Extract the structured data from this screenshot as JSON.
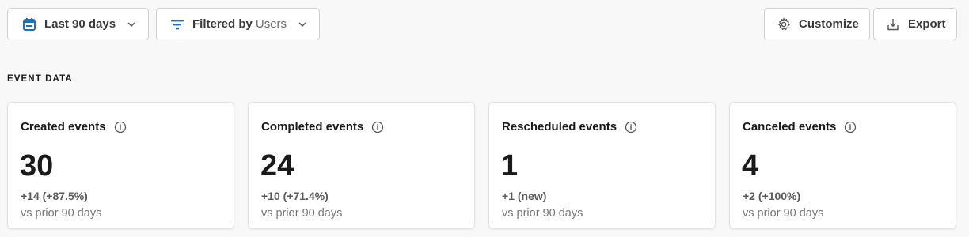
{
  "toolbar": {
    "date_range_label": "Last 90 days",
    "filter_prefix": "Filtered by",
    "filter_value": "Users",
    "customize_label": "Customize",
    "export_label": "Export"
  },
  "section": {
    "title": "EVENT DATA"
  },
  "cards": [
    {
      "title": "Created events",
      "value": "30",
      "delta": "+14 (+87.5%)",
      "comparison": "vs prior 90 days"
    },
    {
      "title": "Completed events",
      "value": "24",
      "delta": "+10 (+71.4%)",
      "comparison": "vs prior 90 days"
    },
    {
      "title": "Rescheduled events",
      "value": "1",
      "delta": "+1 (new)",
      "comparison": "vs prior 90 days"
    },
    {
      "title": "Canceled events",
      "value": "4",
      "delta": "+2 (+100%)",
      "comparison": "vs prior 90 days"
    }
  ],
  "icons": {
    "date": "calendar-icon",
    "filter": "filter-icon",
    "customize": "gear-icon",
    "export": "download-icon",
    "info": "info-icon",
    "chevron": "chevron-down-icon"
  },
  "colors": {
    "accent": "#1d6fc2",
    "icon_gray": "#555555"
  }
}
